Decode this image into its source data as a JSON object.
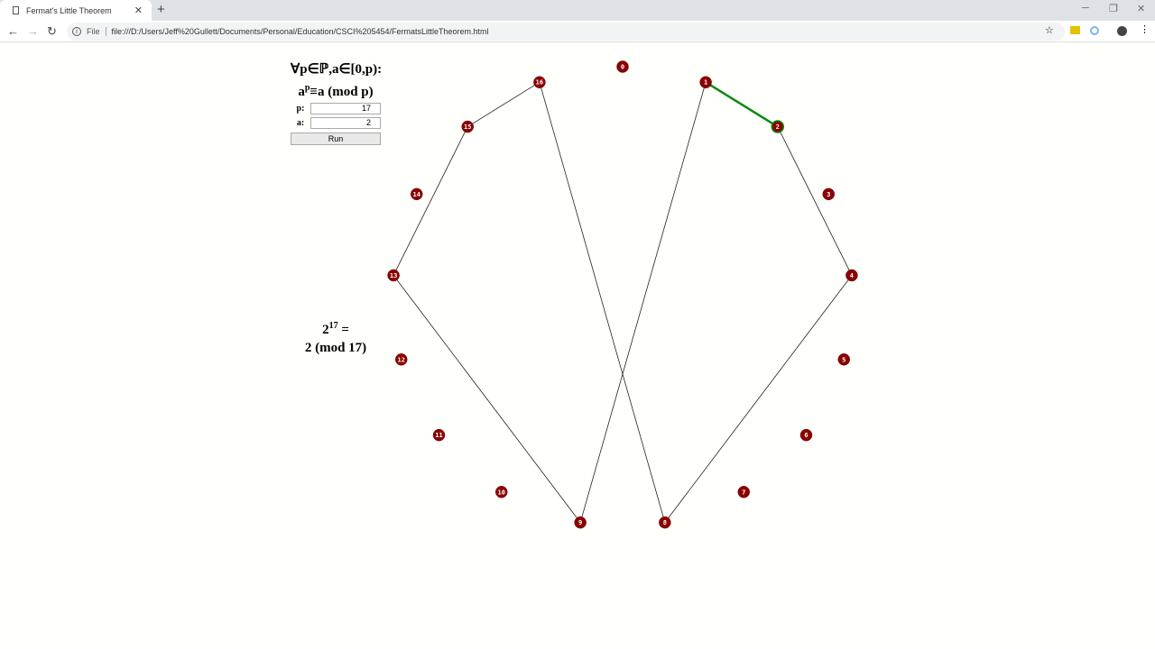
{
  "browser": {
    "tab_title": "Fermat's Little Theorem",
    "url": "file:///D:/Users/Jeff%20Gullett/Documents/Personal/Education/CSCI%205454/FermatsLittleTheorem.html",
    "file_label": "File"
  },
  "panel": {
    "title1": "∀p∈ℙ,a∈[0,p):",
    "title2_base": "a",
    "title2_exp": "p",
    "title2_rest": "≡a (mod p)",
    "p_label": "p:",
    "p_value": "17",
    "a_label": "a:",
    "a_value": "2",
    "run_label": "Run"
  },
  "result": {
    "base": "2",
    "exp": "17",
    "eq": " =",
    "line2": "2 (mod 17)"
  },
  "graph": {
    "modulus": 17,
    "path": [
      1,
      2,
      4,
      8,
      16,
      15,
      13,
      9,
      1
    ],
    "highlight_edge": [
      1,
      2
    ],
    "node_color": "#8b0000",
    "highlight_color": "#0a8a0a",
    "edge_color": "#222222"
  }
}
